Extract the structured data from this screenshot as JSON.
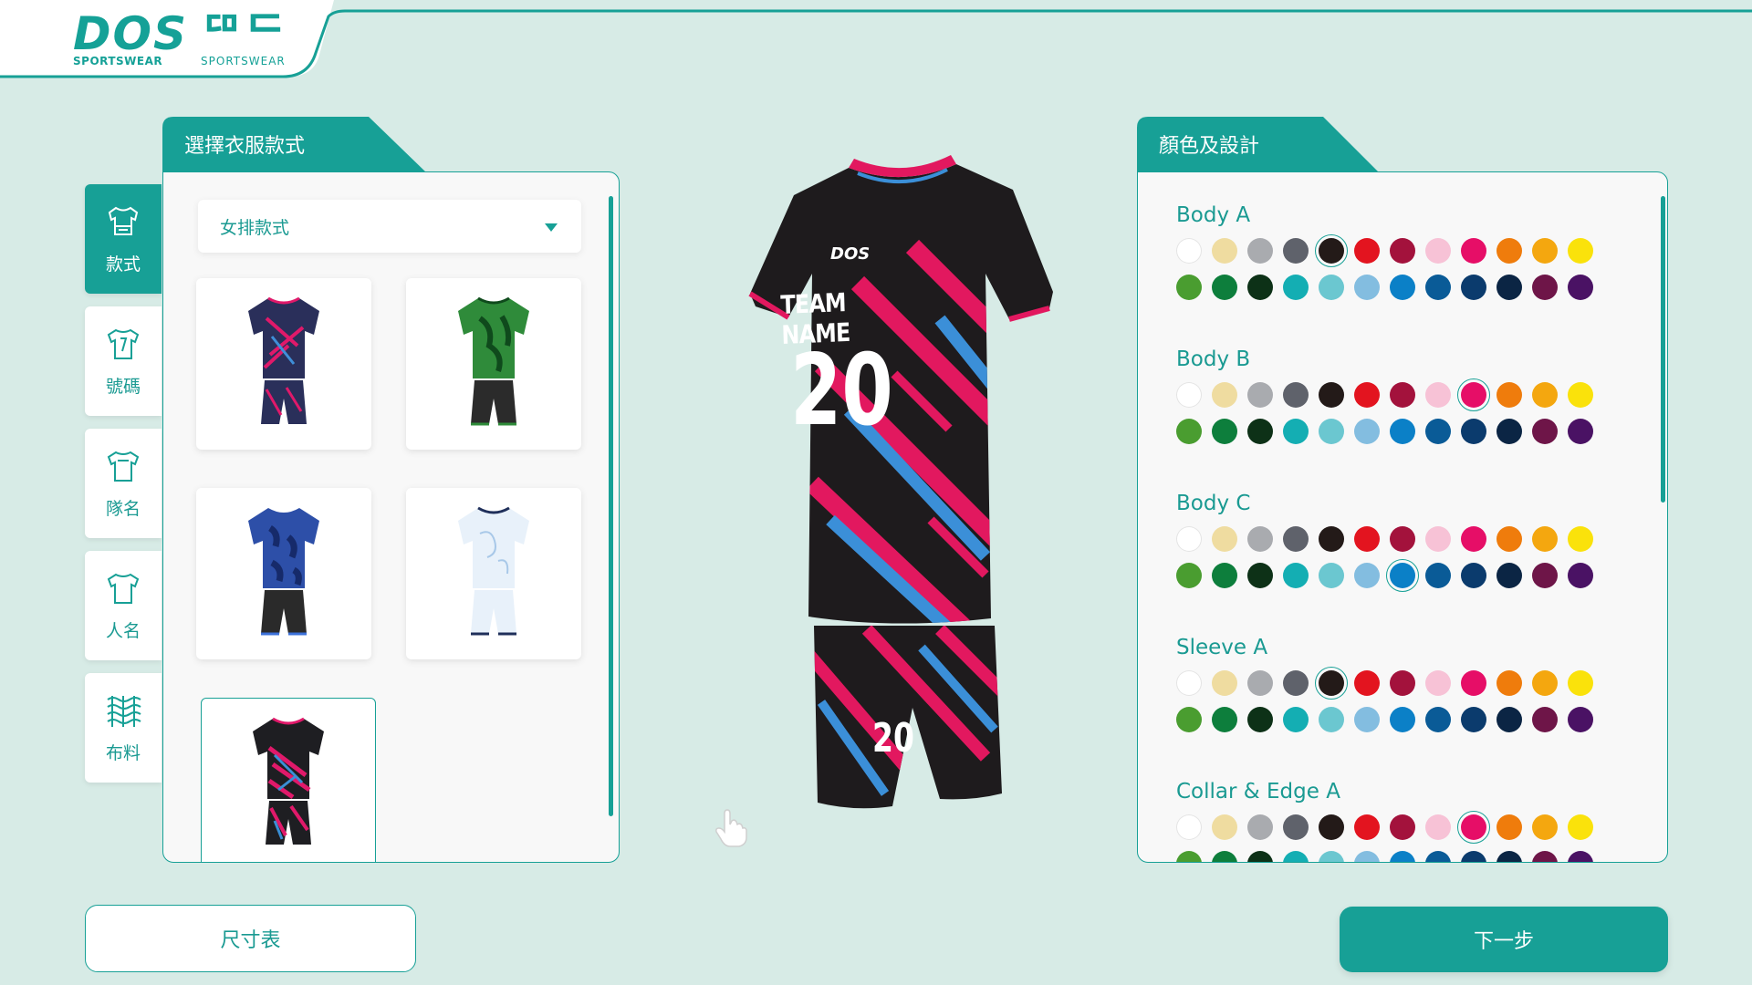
{
  "brand": {
    "logo_main": "DOS",
    "logo_main_alt": "ᄃᄆᄃ",
    "logo_sub": "SPORTSWEAR",
    "logo_sub_alt": "SPORTSWEAR",
    "color": "#15a197"
  },
  "sidenav": {
    "items": [
      {
        "label": "款式",
        "icon": "jersey-style-icon",
        "active": true
      },
      {
        "label": "號碼",
        "icon": "jersey-number-icon",
        "active": false
      },
      {
        "label": "隊名",
        "icon": "team-name-shirt-icon",
        "active": false
      },
      {
        "label": "人名",
        "icon": "player-name-shirt-icon",
        "active": false
      },
      {
        "label": "布料",
        "icon": "fabric-icon",
        "active": false
      }
    ]
  },
  "style_panel": {
    "tab_label": "選擇衣服款式",
    "select_value": "女排款式",
    "thumbnails": [
      {
        "name": "navy-pink-camo-kit",
        "selected": false
      },
      {
        "name": "green-camo-kit",
        "selected": false
      },
      {
        "name": "blue-camo-kit",
        "selected": false
      },
      {
        "name": "white-marble-kit",
        "selected": false
      },
      {
        "name": "black-pink-blue-stripe-kit",
        "selected": true
      }
    ]
  },
  "preview": {
    "team_name": "TEAM NAME",
    "number": "20",
    "short_number": "20",
    "brand_mark": "DOS"
  },
  "color_panel": {
    "tab_label": "顏色及設計",
    "palette_row1": [
      "#ffffff",
      "#efdca0",
      "#a9abaf",
      "#5f626b",
      "#231a18",
      "#e3141f",
      "#a3123c",
      "#f7c2d6",
      "#e60e67",
      "#ef7c0c",
      "#f4a70f",
      "#fae20b"
    ],
    "palette_row2": [
      "#4a9d30",
      "#0d7e3c",
      "#0d3117",
      "#14aeb3",
      "#6bc7d0",
      "#83bde0",
      "#0b80c7",
      "#0a5b97",
      "#0b3b6d",
      "#0b2544",
      "#6e1548",
      "#4a1264"
    ],
    "groups": [
      {
        "label": "Body A",
        "selected_row": 1,
        "selected_index": 4
      },
      {
        "label": "Body B",
        "selected_row": 1,
        "selected_index": 8
      },
      {
        "label": "Body C",
        "selected_row": 2,
        "selected_index": 6
      },
      {
        "label": "Sleeve A",
        "selected_row": 1,
        "selected_index": 4
      },
      {
        "label": "Collar & Edge A",
        "selected_row": 1,
        "selected_index": 8
      }
    ]
  },
  "buttons": {
    "size_chart": "尺寸表",
    "next": "下一步"
  },
  "colors": {
    "accent": "#17a096",
    "background": "#d7ebe6",
    "panel": "#f8f8f8"
  }
}
